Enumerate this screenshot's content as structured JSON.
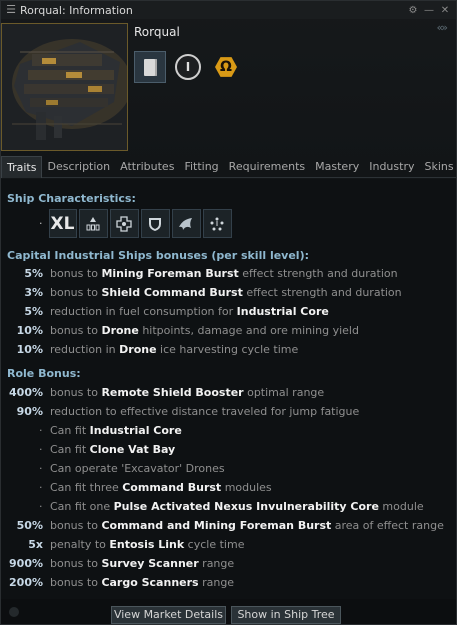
{
  "window": {
    "title": "Rorqual: Information"
  },
  "header": {
    "ship_name": "Rorqual",
    "tech_label": "I",
    "omega_label": "Ω"
  },
  "tabs": [
    {
      "label": "Traits",
      "active": true
    },
    {
      "label": "Description"
    },
    {
      "label": "Attributes"
    },
    {
      "label": "Fitting"
    },
    {
      "label": "Requirements"
    },
    {
      "label": "Mastery"
    },
    {
      "label": "Industry"
    },
    {
      "label": "Skins"
    }
  ],
  "traits": {
    "ship_characteristics_title": "Ship Characteristics:",
    "size_label": "XL",
    "skill_section_title": "Capital Industrial Ships bonuses (per skill level):",
    "skill_bonuses": [
      {
        "value": "5%",
        "pre": "bonus to ",
        "bold": "Mining Foreman Burst",
        "post": " effect strength and duration"
      },
      {
        "value": "3%",
        "pre": "bonus to ",
        "bold": "Shield Command Burst",
        "post": " effect strength and duration"
      },
      {
        "value": "5%",
        "pre": "reduction in fuel consumption for ",
        "bold": "Industrial Core",
        "post": ""
      },
      {
        "value": "10%",
        "pre": "bonus to ",
        "bold": "Drone",
        "post": " hitpoints, damage and ore mining yield"
      },
      {
        "value": "10%",
        "pre": "reduction in ",
        "bold": "Drone",
        "post": " ice harvesting cycle time"
      }
    ],
    "role_section_title": "Role Bonus:",
    "role_bonuses": [
      {
        "value": "400%",
        "pre": "bonus to ",
        "bold": "Remote Shield Booster",
        "post": " optimal range"
      },
      {
        "value": "90%",
        "pre": "reduction to effective distance traveled for jump fatigue",
        "bold": "",
        "post": ""
      },
      {
        "value": "·",
        "pre": "Can fit ",
        "bold": "Industrial Core",
        "post": ""
      },
      {
        "value": "·",
        "pre": "Can fit ",
        "bold": "Clone Vat Bay",
        "post": ""
      },
      {
        "value": "·",
        "pre": "Can operate 'Excavator' Drones",
        "bold": "",
        "post": ""
      },
      {
        "value": "·",
        "pre": "Can fit three ",
        "bold": "Command Burst",
        "post": " modules"
      },
      {
        "value": "·",
        "pre": "Can fit one ",
        "bold": "Pulse Activated Nexus Invulnerability Core",
        "post": " module"
      },
      {
        "value": "50%",
        "pre": "bonus to ",
        "bold": "Command and Mining Foreman Burst",
        "post": " area of effect range"
      },
      {
        "value": "5x",
        "pre": "penalty to ",
        "bold": "Entosis Link",
        "post": " cycle time"
      },
      {
        "value": "900%",
        "pre": "bonus to ",
        "bold": "Survey Scanner",
        "post": " range"
      },
      {
        "value": "200%",
        "pre": "bonus to ",
        "bold": "Cargo Scanners",
        "post": " range"
      }
    ]
  },
  "footer": {
    "market_button": "View Market Details",
    "ship_tree_button": "Show in Ship Tree"
  },
  "icons": {
    "window_menu": "menu-icon",
    "pin": "pin-icon",
    "minimize": "minimize-icon",
    "close": "close-icon",
    "collapse": "collapse-icon",
    "show_info": "document-icon",
    "tech_level": "tech-level-icon",
    "omega": "omega-icon",
    "characteristics": [
      "size-xl-icon",
      "ship-class-icon",
      "fitting-icon",
      "shield-icon",
      "drone-icon",
      "mining-icon"
    ]
  },
  "colors": {
    "section_heading": "#8fb8cf",
    "omega": "#d99a16",
    "ship_frame": "#6b5a2a"
  }
}
